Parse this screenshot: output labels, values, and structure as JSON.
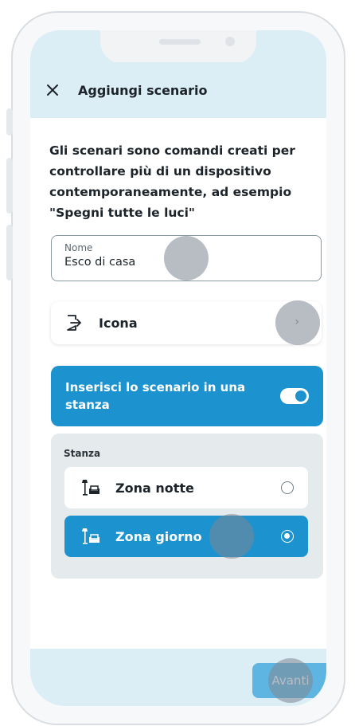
{
  "header": {
    "title": "Aggiungi scenario",
    "close_icon": "close-icon"
  },
  "description": "Gli scenari sono comandi creati per controllare più di un dispositivo contemporaneamente, ad esempio \"Spegni tutte le luci\"",
  "name_field": {
    "label": "Nome",
    "value": "Esco di casa"
  },
  "icon_row": {
    "label": "Icona",
    "icon": "exit-icon",
    "chevron": "›"
  },
  "room_toggle": {
    "label": "Inserisci lo scenario in una stanza",
    "enabled": true
  },
  "rooms": {
    "label": "Stanza",
    "items": [
      {
        "label": "Zona notte",
        "icon": "room-sofa-lamp-icon",
        "selected": false
      },
      {
        "label": "Zona giorno",
        "icon": "room-sofa-lamp-icon",
        "selected": true
      }
    ]
  },
  "footer": {
    "next_label": "Avanti"
  },
  "colors": {
    "accent": "#1c93cf",
    "header_bg": "#dbeef6",
    "next_button": "#5fb5e1"
  }
}
